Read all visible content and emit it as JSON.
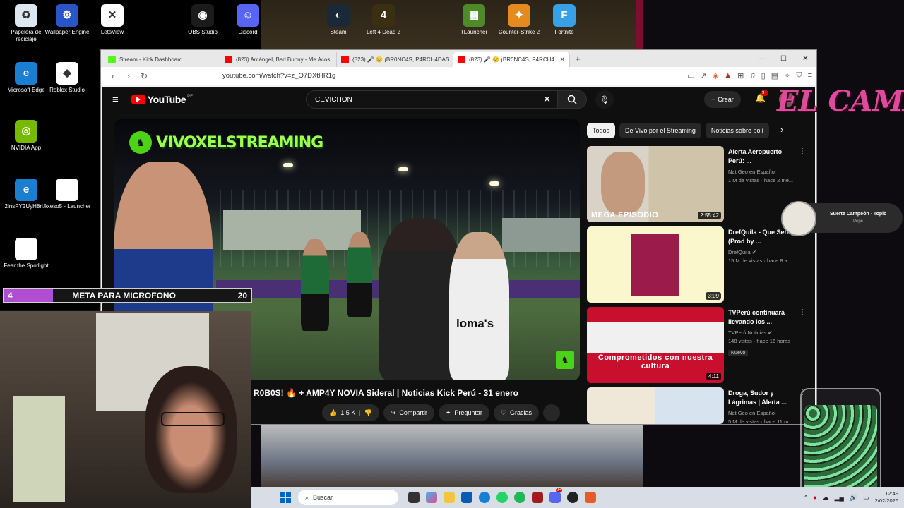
{
  "desktop": {
    "icons": [
      {
        "label": "Papelera de reciclaje",
        "icon": "recycle-bin-icon",
        "glyph": "♻",
        "color": "#dde7f0"
      },
      {
        "label": "Wallpaper Engine",
        "icon": "wallpaper-engine-icon",
        "glyph": "⚙",
        "color": "#2a55c9"
      },
      {
        "label": "LetsView",
        "icon": "letsview-icon",
        "glyph": "✕",
        "color": "#ffffff"
      },
      {
        "label": "OBS Studio",
        "icon": "obs-icon",
        "glyph": "◉",
        "color": "#1b1b1b"
      },
      {
        "label": "Discord",
        "icon": "discord-icon",
        "glyph": "☺",
        "color": "#5865f2"
      },
      {
        "label": "Steam",
        "icon": "steam-icon",
        "glyph": "◐",
        "color": "#1b2838"
      },
      {
        "label": "Left 4 Dead 2",
        "icon": "left4dead2-icon",
        "glyph": "4",
        "color": "#3b2f12"
      },
      {
        "label": "TLauncher",
        "icon": "tlauncher-icon",
        "glyph": "▦",
        "color": "#4e8a2a"
      },
      {
        "label": "Counter-Strike 2",
        "icon": "cs2-icon",
        "glyph": "✦",
        "color": "#e58a1f"
      },
      {
        "label": "Fortnite",
        "icon": "fortnite-icon",
        "glyph": "F",
        "color": "#37a0e6"
      },
      {
        "label": "Microsoft Edge",
        "icon": "edge-icon",
        "glyph": "e",
        "color": "#1a7fd1"
      },
      {
        "label": "Roblox Studio",
        "icon": "roblox-studio-icon",
        "glyph": "◆",
        "color": "#ffffff"
      },
      {
        "label": "NVIDIA App",
        "icon": "nvidia-icon",
        "glyph": "◎",
        "color": "#76b900"
      },
      {
        "label": "2insPY2UyH8ri...",
        "icon": "edge-shortcut-icon",
        "glyph": "e",
        "color": "#1a7fd1"
      },
      {
        "label": "Axeso5 - Launcher",
        "icon": "file-icon",
        "glyph": "",
        "color": "#ffffff"
      },
      {
        "label": "Fear the Spotlight",
        "icon": "file-icon",
        "glyph": "",
        "color": "#ffffff"
      }
    ]
  },
  "browser": {
    "tabs": [
      {
        "label": "Stream - Kick Dashboard",
        "fav": "#53fc18"
      },
      {
        "label": "(823) Arcángel, Bad Bunny - Me Acos",
        "fav": "#ff0000"
      },
      {
        "label": "(823) 🎤 😢 ¡BR0NC4S, P4RCH4DAS",
        "fav": "#ff0000"
      },
      {
        "label": "(823) 🎤 😢 ¡BR0NC4S, P4RCH4",
        "fav": "#ff0000"
      }
    ],
    "new_tab": "+",
    "url": "youtube.com/watch?v=z_O7DXtHR1g"
  },
  "youtube": {
    "brand": "YouTube",
    "region": "PE",
    "search_query": "CEVICHON",
    "create_label": "Crear",
    "notif_count": "9+",
    "video": {
      "watermark": "VIVOXELSTREAMING",
      "shirt_text": "loma's",
      "title": "R0B0S! 🔥 + AMP4Y NOVIA Sideral | Noticias Kick Perú - 31 enero",
      "likes": "1.5 K",
      "share": "Compartir",
      "ask": "Preguntar",
      "thanks": "Gracias"
    },
    "chips": [
      "Todos",
      "De Vivo por el Streaming",
      "Noticias sobre polí"
    ],
    "recommendations": [
      {
        "title": "Alerta Aeropuerto Perú: ...",
        "channel": "Nat Geo en Español",
        "stats": "1 M de vistas · hace 2 me...",
        "duration": "2:55:42",
        "overlay": "MEGA EPISODIO",
        "badge": "",
        "verified": false
      },
      {
        "title": "DrefQuila - Que Será🤔 (Prod by ...",
        "channel": "DrefQuila",
        "stats": "15 M de vistas · hace 8 a...",
        "duration": "3:09",
        "overlay": "",
        "badge": "",
        "verified": true
      },
      {
        "title": "TVPerú continuará llevando los ...",
        "channel": "TVPerú Noticias",
        "stats": "148 vistas · hace 16 horas",
        "duration": "4:11",
        "overlay": "Comprometidos con nuestra cultura",
        "badge": "Nuevo",
        "verified": true
      },
      {
        "title": "Droga, Sudor y Lágrimas | Alerta ...",
        "channel": "Nat Geo en Español",
        "stats": "5 M de vistas · hace 11 m...",
        "duration": "",
        "overlay": "",
        "badge": "",
        "verified": false
      }
    ]
  },
  "overlays": {
    "goal_current": "4",
    "goal_label": "META PARA MICROFONO",
    "goal_target": "20",
    "goal_fraction": 0.2,
    "logo_text": "EL CAMAL",
    "now_playing": {
      "title": "Suerte Campeón - Topic",
      "artist": "Pepé"
    }
  },
  "taskbar": {
    "search_label": "Buscar",
    "time": "12:49",
    "date": "2/02/2026",
    "discord_badge": "9+"
  }
}
